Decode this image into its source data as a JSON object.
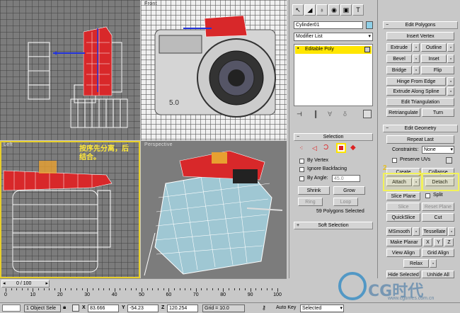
{
  "viewports": {
    "top_left_label": "",
    "front_label": "Front",
    "left_label": "Left",
    "perspective_label": "Perspective",
    "annotation": "按序先分离，后\n结合。"
  },
  "command_panel": {
    "tabs": [
      "create-icon",
      "modify-icon",
      "hierarchy-icon",
      "motion-icon",
      "display-icon",
      "utilities-icon"
    ],
    "object_name": "Cylinder01",
    "object_color": "#8fd0e8",
    "modifier_list": "Modifier List",
    "stack_item": "Editable Poly",
    "selection": {
      "header": "Selection",
      "by_vertex": "By Vertex",
      "ignore_backfacing": "Ignore Backfacing",
      "by_angle": "By Angle:",
      "angle_value": "45.0",
      "shrink": "Shrink",
      "grow": "Grow",
      "ring": "Ring",
      "loop": "Loop",
      "status": "59 Polygons Selected"
    },
    "soft_selection": "Soft Selection"
  },
  "edit_polygons": {
    "header": "Edit Polygons",
    "insert_vertex": "Insert Vertex",
    "extrude": "Extrude",
    "outline": "Outline",
    "bevel": "Bevel",
    "inset": "Inset",
    "bridge": "Bridge",
    "flip": "Flip",
    "hinge_from_edge": "Hinge From Edge",
    "extrude_along_spline": "Extrude Along Spline",
    "edit_triangulation": "Edit Triangulation",
    "retriangulate": "Retriangulate",
    "turn": "Turn"
  },
  "edit_geometry": {
    "header": "Edit Geometry",
    "repeat_last": "Repeat Last",
    "constraints": "Constraints:",
    "constraints_value": "None",
    "preserve_uvs": "Preserve UVs",
    "create": "Create",
    "collapse": "Collapse",
    "attach": "Attach",
    "detach": "Detach",
    "marker_1": "1",
    "marker_2": "2",
    "slice_plane": "Slice Plane",
    "split": "Split",
    "slice": "Slice",
    "reset_plane": "Reset Plane",
    "quickslice": "QuickSlice",
    "cut": "Cut",
    "msmooth": "MSmooth",
    "tessellate": "Tessellate",
    "make_planar": "Make Planar",
    "x": "X",
    "y": "Y",
    "z": "Z",
    "view_align": "View Align",
    "grid_align": "Grid Align",
    "relax": "Relax",
    "hide_selected": "Hide Selected",
    "unhide_all": "Unhide All"
  },
  "timeline": {
    "counter": "0 / 100",
    "ticks": [
      "0",
      "10",
      "20",
      "30",
      "40",
      "50",
      "60",
      "70",
      "80",
      "90",
      "100"
    ]
  },
  "status_bar": {
    "selection": "1 Object Sele",
    "x_label": "X",
    "x_value": "83.666",
    "y_label": "Y",
    "y_value": "-54.23",
    "z_label": "Z",
    "z_value": "120.254",
    "grid": "Grid = 10.0",
    "auto_key": "Auto Key",
    "selected": "Selected"
  },
  "watermark": "CG时代",
  "watermark_url": "www.cgtimes.com.cn",
  "colors": {
    "viewport_bg": "#7c7c7c",
    "selected_poly": "#d8282a",
    "mesh_white": "#ffffff",
    "perspective_mesh": "#9fc7d3",
    "highlight": "#f2f25a",
    "active_viewport": "#e8cf2a"
  }
}
